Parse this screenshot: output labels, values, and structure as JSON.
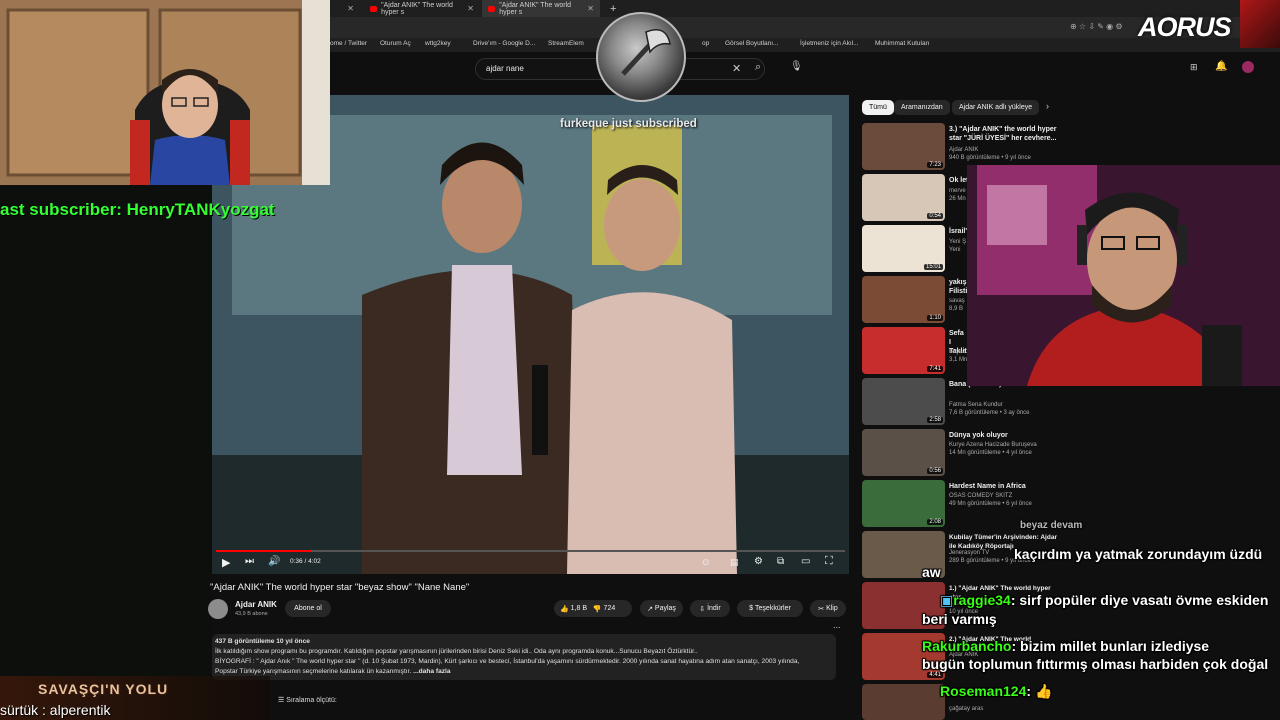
{
  "browser": {
    "tabs": [
      {
        "label": "\"Ajdar ANIK\" The world hyper s"
      },
      {
        "label": "\"Ajdar ANIK\" The world hyper s"
      }
    ],
    "new_tab_symbol": "+",
    "bookmarks": [
      "ome / Twitter",
      "Oturum Aç",
      "wttg2key",
      "Drive'ım - Google D...",
      "StreamElem",
      "op",
      "Görsel Boyutlanı...",
      "İşletmeniz için Akıl...",
      "Muhimmat Kutuları"
    ]
  },
  "youtube": {
    "search_query": "ajdar nane",
    "video": {
      "time": "0:36 / 4:02",
      "title": "\"Ajdar ANIK\" The world hyper star \"beyaz show\" \"Nane Nane\"",
      "channel": "Ajdar ANIK",
      "subscribers": "43,9 B abone",
      "subscribe_label": "Abone ol",
      "likes": "1,8 B",
      "dislikes": "724",
      "share_label": "Paylaş",
      "download_label": "İndir",
      "thanks_label": "Teşekkürler",
      "clip_label": "Klip",
      "more_label": "...",
      "views_line": "437 B görüntüleme  10 yıl önce",
      "description_1": "İlk katıldığım show programı bu programdır. Katıldığım popstar yarışmasının jürilerinden birisi Deniz Seki idi.. Oda aynı programda konuk...Sunucu Beyazıt Öztürktür..",
      "description_2": "BİYOGRAFİ : \" Ajdar Anık \" The world hyper star \" (d. 10 Şubat 1973, Mardin), Kürt şarkıcı ve bestecí, İstanbul'da yaşamını sürdürmektedir. 2000 yılında sanat hayatına adım atan sanatçı, 2003 yılında,",
      "description_3": "Popstar Türkiye yarışmasının seçmelerine katılarak ün kazanmıştır.",
      "more_link": "...daha fazla",
      "sort_label": "Sıralama ölçütü:"
    },
    "chips": [
      "Tümü",
      "Aramanızdan",
      "Ajdar ANIK adlı yükleye"
    ],
    "recommendations": [
      {
        "title": "3.) \"Ajdar ANIK\" the world hyper star \"JÜRİ ÜYESİ\" her cevhere...",
        "channel": "Ajdar ANIK",
        "meta": "940 B görüntüleme  •  9 yıl önce",
        "duration": "7:23",
        "color": "#6b4b3c"
      },
      {
        "title": "Ok let",
        "channel": "merve",
        "meta": "26 Mn",
        "duration": "0:54",
        "color": "#d6c7b7"
      },
      {
        "title": "İsrail'",
        "channel": "Yeni Ş",
        "meta": "Yeni",
        "duration": "15:01",
        "color": "#ece3d4"
      },
      {
        "title": "yakışı Filisti",
        "channel": "savaş",
        "meta": "8,9 B",
        "duration": "1:10",
        "color": "#7b4b35"
      },
      {
        "title": "Sefa I Taklit",
        "channel": "Beyaz",
        "meta": "3,1 Mn",
        "duration": "7:41",
        "color": "#c72d2d"
      },
      {
        "title": "Bana (AI Cover)",
        "channel": "Fatma Sena Kundur",
        "meta": "7,6 B görüntüleme  •  3 ay önce",
        "duration": "2:58",
        "color": "#4c4c4c"
      },
      {
        "title": "Dünya yok oluyor",
        "channel": "Kurye Azena Hacizade Buruşeva",
        "meta": "14 Mn görüntüleme  •  4 yıl önce",
        "duration": "0:56",
        "color": "#5a5048"
      },
      {
        "title": "Hardest Name in Africa",
        "channel": "OSAS COMEDY SKITZ",
        "meta": "49 Mn görüntüleme  •  6 yıl önce",
        "duration": "2:08",
        "color": "#3a6b3a"
      },
      {
        "title": "Kubilay Tümer'in Arşivinden: Ajdar ile Kadıköy Röportajı",
        "channel": "Jenerasyon TV",
        "meta": "289 B görüntüleme  •  9 yıl önce",
        "duration": "",
        "color": "#6a5a4a"
      },
      {
        "title": "1.) \"Ajdar ANIK\" The world hyper star",
        "channel": "Ajdar ANIK",
        "meta": "10 yıl önce",
        "duration": "",
        "color": "#8b3030"
      },
      {
        "title": "2.) \"Ajdar ANIK\" The world",
        "channel": "Ajdar ANIK",
        "meta": "",
        "duration": "4:41",
        "color": "#a43a2f"
      },
      {
        "title": "",
        "channel": "çağatay aras",
        "meta": "",
        "duration": "",
        "color": "#5a3c30"
      }
    ]
  },
  "overlay": {
    "last_subscriber_prefix": "ast subscriber: ",
    "last_subscriber_name": "HenryTANKyozgat",
    "sub_alert_user": "furkeque",
    "sub_alert_text": " just subscribed",
    "logo_text": "AORUS",
    "brand_text": "SAVAŞÇI'N YOLU",
    "ticker": "sürtük : alperentik",
    "chat": [
      {
        "user": "",
        "text": "kaçırdım ya yatmak zorundayım üzdü"
      },
      {
        "user": "aw",
        "text": ""
      },
      {
        "user": "raggie34",
        "text": ": sirf popüler diye vasatı övme eskiden"
      },
      {
        "user": "",
        "text": "beri varmış"
      },
      {
        "user": "Rakurbancho",
        "text": ": bizim millet bunları izlediyse"
      },
      {
        "user": "",
        "text": "bugün toplumun fıttırmış olması harbiden çok doğal"
      },
      {
        "user": "Roseman124",
        "text": ": 👍"
      }
    ],
    "chat_overlap_text": "beyaz devam"
  }
}
